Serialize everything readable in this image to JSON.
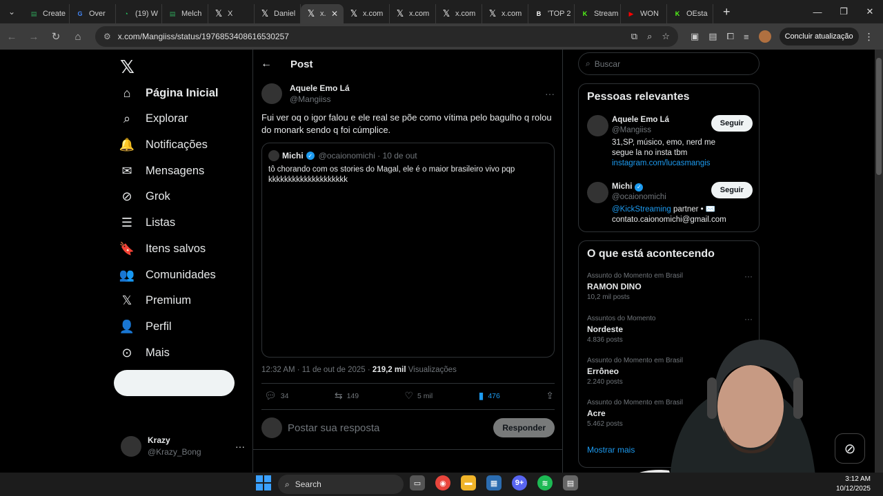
{
  "browser": {
    "tabs": [
      {
        "label": "Create",
        "icon": "sheets-icon",
        "color": "#2fa35a"
      },
      {
        "label": "Over",
        "icon": "google-icon",
        "color": "#4285f4"
      },
      {
        "label": "(19) W",
        "icon": "whatsapp-icon",
        "color": "#25d366"
      },
      {
        "label": "Melch",
        "icon": "sheets-icon",
        "color": "#2fa35a"
      },
      {
        "label": "X",
        "icon": "x-icon",
        "color": "#ffffff"
      },
      {
        "label": "Daniel",
        "icon": "x-icon",
        "color": "#ffffff"
      },
      {
        "label": "x.",
        "icon": "x-icon",
        "color": "#ffffff",
        "active": true
      },
      {
        "label": "x.com",
        "icon": "x-icon",
        "color": "#ffffff"
      },
      {
        "label": "x.com",
        "icon": "x-icon",
        "color": "#ffffff"
      },
      {
        "label": "x.com",
        "icon": "x-icon",
        "color": "#ffffff"
      },
      {
        "label": "x.com",
        "icon": "x-icon",
        "color": "#ffffff"
      },
      {
        "label": "'TOP 2",
        "icon": "b-icon",
        "color": "#ffffff"
      },
      {
        "label": "Stream",
        "icon": "kick-icon",
        "color": "#53fc18"
      },
      {
        "label": "WON",
        "icon": "youtube-icon",
        "color": "#ff0000"
      },
      {
        "label": "OEsta",
        "icon": "kick-icon",
        "color": "#53fc18"
      }
    ],
    "url": "x.com/Mangiiss/status/1976853408616530257",
    "update_label": "Concluir atualização"
  },
  "nav": {
    "items": [
      {
        "label": "Página Inicial",
        "icon": "home-icon",
        "glyph": "⌂"
      },
      {
        "label": "Explorar",
        "icon": "search-icon",
        "glyph": "⌕"
      },
      {
        "label": "Notificações",
        "icon": "bell-icon",
        "glyph": "🔔"
      },
      {
        "label": "Mensagens",
        "icon": "mail-icon",
        "glyph": "✉"
      },
      {
        "label": "Grok",
        "icon": "grok-icon",
        "glyph": "⊘"
      },
      {
        "label": "Listas",
        "icon": "list-icon",
        "glyph": "☰"
      },
      {
        "label": "Itens salvos",
        "icon": "bookmark-icon",
        "glyph": "🔖"
      },
      {
        "label": "Comunidades",
        "icon": "communities-icon",
        "glyph": "👥"
      },
      {
        "label": "Premium",
        "icon": "x-icon",
        "glyph": "𝕏"
      },
      {
        "label": "Perfil",
        "icon": "profile-icon",
        "glyph": "👤"
      },
      {
        "label": "Mais",
        "icon": "more-circle-icon",
        "glyph": "⊙"
      }
    ],
    "account": {
      "name": "Krazy",
      "handle": "@Krazy_Bong"
    }
  },
  "post": {
    "header": "Post",
    "author_name": "Aquele Emo Lá",
    "author_handle": "@Mangiiss",
    "text": "Fui ver oq o igor falou e ele real se põe como vítima pelo bagulho q rolou do monark sendo q foi cúmplice.",
    "quote": {
      "name": "Michi",
      "meta": "@ocaionomichi · 10 de out",
      "text": "tô chorando com os stories do Magal, ele é o maior brasileiro vivo pqp kkkkkkkkkkkkkkkkkkkk"
    },
    "time": "12:32 AM · 11 de out de 2025 ·",
    "views_count": "219,2 mil",
    "views_label": "Visualizações",
    "replies": "34",
    "reposts": "149",
    "likes": "5 mil",
    "bookmarks": "476",
    "reply_placeholder": "Postar sua resposta",
    "reply_button": "Responder"
  },
  "sidebar": {
    "search_placeholder": "Buscar",
    "relevant_title": "Pessoas relevantes",
    "people": [
      {
        "name": "Aquele Emo Lá",
        "handle": "@Mangiiss",
        "bio": "31,SP, músico, emo, nerd me segue la no insta tbm",
        "link": "instagram.com/lucasmangis",
        "follow": "Seguir"
      },
      {
        "name": "Michi",
        "handle": "@ocaionomichi",
        "bio_link": "@KickStreaming",
        "bio": "partner • ✉️ contato.caionomichi@gmail.com",
        "follow": "Seguir"
      }
    ],
    "trends_title": "O que está acontecendo",
    "trends": [
      {
        "context": "Assunto do Momento em Brasil",
        "title": "RAMON DINO",
        "posts": "10,2 mil posts"
      },
      {
        "context": "Assuntos do Momento",
        "title": "Nordeste",
        "posts": "4.836 posts"
      },
      {
        "context": "Assunto do Momento em Brasil",
        "title": "Errôneo",
        "posts": "2.240 posts"
      },
      {
        "context": "Assunto do Momento em Brasil",
        "title": "Acre",
        "posts": "5.462 posts"
      }
    ],
    "show_more": "Mostrar mais"
  },
  "taskbar": {
    "search": "Search",
    "time": "3:12 AM",
    "date": "10/12/2025",
    "badge": "9+"
  }
}
